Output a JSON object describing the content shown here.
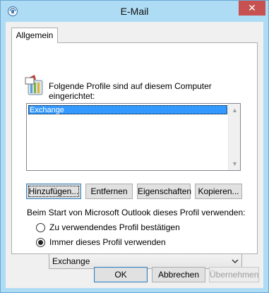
{
  "window": {
    "title": "E-Mail",
    "close_glyph": "✕"
  },
  "tabs": [
    {
      "label": "Allgemein"
    }
  ],
  "intro_label": "Folgende Profile sind auf diesem Computer eingerichtet:",
  "profiles_list": {
    "items": [
      "Exchange"
    ],
    "selected": "Exchange"
  },
  "profile_buttons": {
    "add": "Hinzufügen...",
    "remove": "Entfernen",
    "properties": "Eigenschaften",
    "copy": "Kopieren..."
  },
  "startup": {
    "label": "Beim Start von Microsoft Outlook dieses Profil verwenden:",
    "option_prompt": "Zu verwendendes Profil bestätigen",
    "option_always": "Immer dieses Profil verwenden",
    "selected_option": "always",
    "profile_select_value": "Exchange"
  },
  "dialog_buttons": {
    "ok": "OK",
    "cancel": "Abbrechen",
    "apply": "Übernehmen"
  },
  "icons": {
    "app": "outlook-mail-icon",
    "profile": "mail-profiles-icon"
  }
}
